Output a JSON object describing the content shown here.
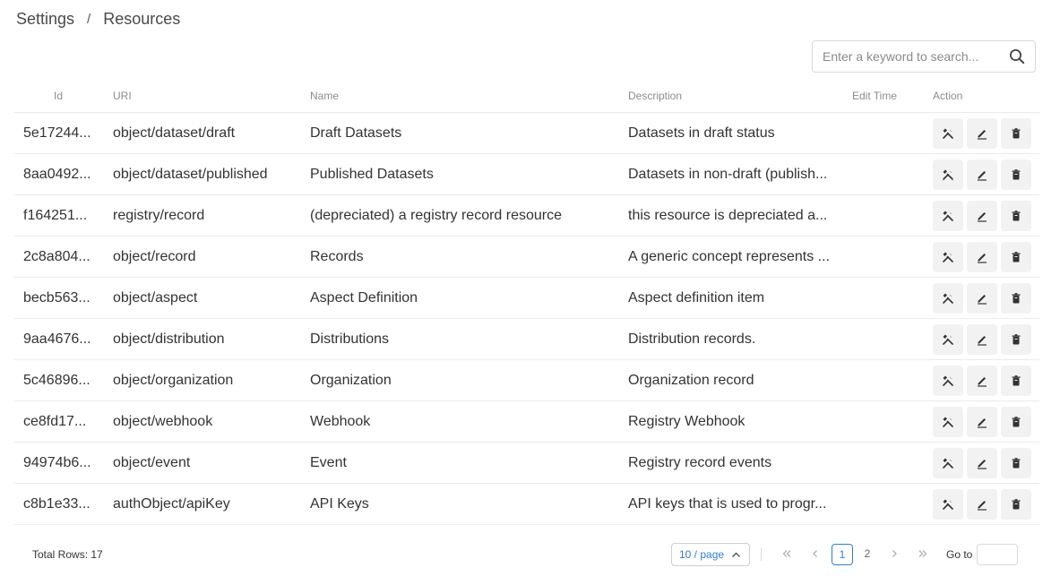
{
  "breadcrumb": {
    "root": "Settings",
    "separator": "/",
    "current": "Resources"
  },
  "search": {
    "placeholder": "Enter a keyword to search..."
  },
  "table": {
    "columns": {
      "id": "Id",
      "uri": "URI",
      "name": "Name",
      "description": "Description",
      "edit_time": "Edit Time",
      "action": "Action"
    },
    "rows": [
      {
        "id": "5e17244...",
        "uri": "object/dataset/draft",
        "name": "Draft Datasets",
        "description": "Datasets in draft status",
        "edit_time": ""
      },
      {
        "id": "8aa0492...",
        "uri": "object/dataset/published",
        "name": "Published Datasets",
        "description": "Datasets in non-draft (publish...",
        "edit_time": ""
      },
      {
        "id": "f164251...",
        "uri": "registry/record",
        "name": "(depreciated) a registry record resource",
        "description": "this resource is depreciated a...",
        "edit_time": ""
      },
      {
        "id": "2c8a804...",
        "uri": "object/record",
        "name": "Records",
        "description": "A generic concept represents ...",
        "edit_time": ""
      },
      {
        "id": "becb563...",
        "uri": "object/aspect",
        "name": "Aspect Definition",
        "description": "Aspect definition item",
        "edit_time": ""
      },
      {
        "id": "9aa4676...",
        "uri": "object/distribution",
        "name": "Distributions",
        "description": "Distribution records.",
        "edit_time": ""
      },
      {
        "id": "5c46896...",
        "uri": "object/organization",
        "name": "Organization",
        "description": "Organization record",
        "edit_time": ""
      },
      {
        "id": "ce8fd17...",
        "uri": "object/webhook",
        "name": "Webhook",
        "description": "Registry Webhook",
        "edit_time": ""
      },
      {
        "id": "94974b6...",
        "uri": "object/event",
        "name": "Event",
        "description": "Registry record events",
        "edit_time": ""
      },
      {
        "id": "c8b1e33...",
        "uri": "authObject/apiKey",
        "name": "API Keys",
        "description": "API keys that is used to progr...",
        "edit_time": ""
      }
    ],
    "action_icons": [
      "tools-icon",
      "edit-icon",
      "delete-icon"
    ]
  },
  "footer": {
    "total_rows": "Total Rows: 17",
    "page_size": "10 / page",
    "pages": [
      "1",
      "2"
    ],
    "current_page": "1",
    "goto_label": "Go to",
    "goto_value": ""
  },
  "colors": {
    "accent": "#2f7fd3",
    "border": "#ebebeb",
    "action_bg": "#f2f2f2"
  }
}
